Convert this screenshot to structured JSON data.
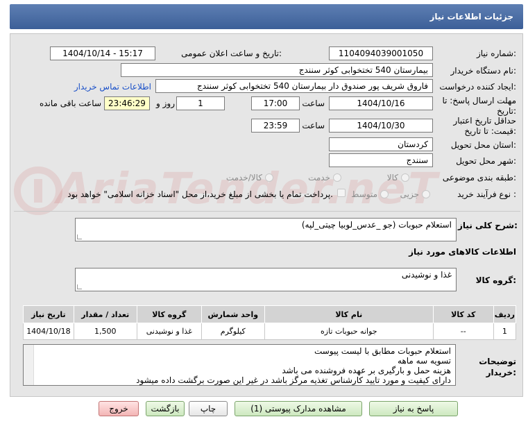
{
  "header": {
    "title": "جزئیات اطلاعات نیاز"
  },
  "fields": {
    "need_number_label": "شماره نیاز:",
    "need_number": "1104094039001050",
    "announce_label": "تاریخ و ساعت اعلان عمومی:",
    "announce_value": "1404/10/14 - 15:17",
    "buyer_org_label": "نام دستگاه خریدار:",
    "buyer_org": "بیمارستان 540 تختخوابی کوثر سنندج",
    "creator_label": "ایجاد کننده درخواست:",
    "creator": "فاروق شریف پور صندوق دار بیمارستان 540 تختخوابی کوثر سنندج",
    "contact_link": "اطلاعات تماس خریدار",
    "deadline_label_1": "مهلت ارسال پاسخ: تا",
    "deadline_label_2": "تاریخ:",
    "deadline_date": "1404/10/16",
    "time_label": "ساعت",
    "deadline_time": "17:00",
    "days_value": "1",
    "days_label": "روز و",
    "remaining_time": "23:46:29",
    "remaining_label": "ساعت باقی مانده",
    "validity_label_1": "حداقل تاریخ اعتبار",
    "validity_label_2": "قیمت: تا تاریخ:",
    "validity_date": "1404/10/30",
    "validity_time": "23:59",
    "province_label": "استان محل تحویل:",
    "province": "کردستان",
    "city_label": "شهر محل تحویل:",
    "city": "سنندج",
    "category_label": "طبقه بندی موضوعی:",
    "category_options": [
      "کالا",
      "خدمت",
      "کالا/خدمت"
    ],
    "process_label": "نوع فرآیند خرید :",
    "process_options": [
      "جزیی",
      "متوسط"
    ],
    "payment_note": "پرداخت تمام یا بخشی از مبلغ خرید،از محل \"اسناد خزانه اسلامی\" خواهد بود."
  },
  "description": {
    "label": "شرح کلی نیاز:",
    "value": "استعلام حبوبات (جو _عدس_لوبیا چیتی_لپه)"
  },
  "goods_section": {
    "title": "اطلاعات کالاهای مورد نیاز",
    "group_label": "گروه کالا:",
    "group_value": "غذا و نوشیدنی"
  },
  "table": {
    "headers": [
      "ردیف",
      "کد کالا",
      "نام کالا",
      "واحد شمارش",
      "گروه کالا",
      "تعداد / مقدار",
      "تاریخ نیاز"
    ],
    "rows": [
      [
        "1",
        "--",
        "جوانه حبوبات تازه",
        "کیلوگرم",
        "غذا و نوشیدنی",
        "1,500",
        "1404/10/18"
      ]
    ]
  },
  "buyer_notes": {
    "label_1": "توضیحات",
    "label_2": "خریدار:",
    "lines": [
      "استعلام حبوبات مطابق با لیست پیوست",
      "تسویه سه ماهه",
      "هزینه حمل و بارگیری بر عهده فروشنده می باشد",
      "دارای کیفیت و مورد تایید کارشناس تغذیه مرگز باشد در غیر این صورت برگشت داده میشود"
    ]
  },
  "buttons": {
    "reply": "پاسخ به نیاز",
    "attachments": "مشاهده مدارک پیوستی (1)",
    "print": "چاپ",
    "back": "بازگشت",
    "exit": "خروج"
  },
  "watermark": "AriaTender.neT"
}
